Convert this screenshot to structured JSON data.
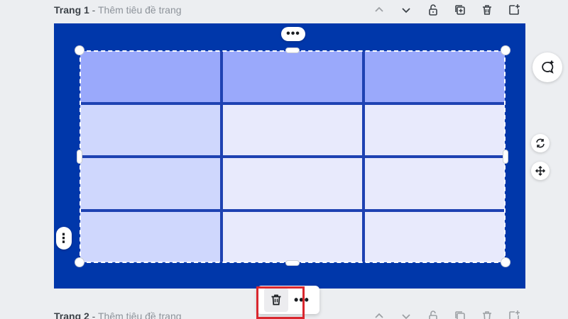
{
  "pages": [
    {
      "title_prefix": "Trang 1",
      "separator": " - ",
      "title_placeholder": "Thêm tiêu đề trang"
    },
    {
      "title_prefix": "Trang 2",
      "separator": " - ",
      "title_placeholder": "Thêm tiêu đề trang"
    }
  ],
  "page_actions": [
    "chevron-up-icon",
    "chevron-down-icon",
    "lock-icon",
    "duplicate-page-icon",
    "delete-page-icon",
    "add-page-icon"
  ],
  "canvas": {
    "background": "#0037aa"
  },
  "table": {
    "rows": 4,
    "columns": 3,
    "header_color": "#9aa9fb",
    "first_column_color": "#cfd7fd",
    "cell_color": "#e8eafc",
    "border_color": "#1e42b2"
  },
  "controls": {
    "top_more": "•••",
    "side_more": "⋮",
    "toolbar_more": "•••"
  },
  "side_buttons": [
    "comment-add-icon",
    "rotate-icon",
    "move-icon"
  ],
  "colors": {
    "highlight": "#d9272e"
  }
}
